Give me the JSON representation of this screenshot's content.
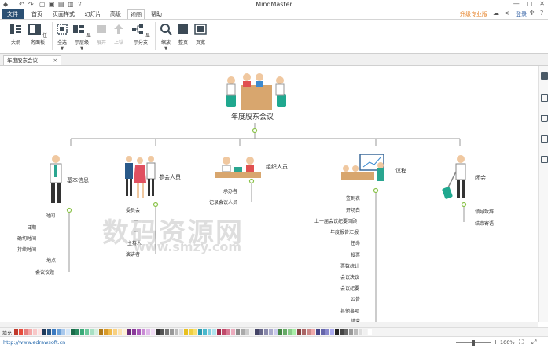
{
  "app": {
    "title": "MindMaster",
    "upgrade": "升级专业版",
    "login": "登录"
  },
  "tabs": [
    "文件",
    "首页",
    "页面样式",
    "幻灯片",
    "高级",
    "视图",
    "帮助"
  ],
  "active_tab": "视图",
  "ribbon": {
    "outline": "大纲",
    "task_panel": "任务面板",
    "select_all": "全选",
    "show_level": "显示层级",
    "expand": "展开",
    "move_up": "上钻",
    "show_branch": "显示分支",
    "zoom": "缩放",
    "fit_page": "整页",
    "page_width": "页宽"
  },
  "doc_tab": "年度股东会议",
  "mindmap": {
    "root": "年度股东会议",
    "branches": [
      {
        "label": "基本信息",
        "children": [
          "时间",
          "日期",
          "确切时间",
          "持续时间",
          "地点",
          "会议议题"
        ]
      },
      {
        "label": "参会人员",
        "children": [
          "委员会",
          "…",
          "…",
          "主持人",
          "演讲者"
        ]
      },
      {
        "label": "组织人员",
        "children": [
          "承办者",
          "记录会议人员"
        ]
      },
      {
        "label": "议程",
        "children": [
          "签到表",
          "开场白",
          "上一届会议纪要回顾",
          "年度报告汇报",
          "任命",
          "投票",
          "票数统计",
          "会议决议",
          "会议纪要",
          "公告",
          "其他事项",
          "结束"
        ]
      },
      {
        "label": "闭会",
        "children": [
          "领导致辞",
          "结束寄语"
        ]
      }
    ]
  },
  "watermark": {
    "line1": "数码资源网",
    "line2": "www.smzy.com"
  },
  "palette_label": "填充",
  "status": {
    "url": "http://www.edrawsoft.cn",
    "zoom": "100%"
  },
  "colors": {
    "file_tab": "#2a4f73",
    "connector": "#999999",
    "node_dot": "#8bc34a",
    "link": "#2266aa"
  },
  "icons": [
    "undo-icon",
    "redo-icon",
    "save-icon",
    "print-icon",
    "outline-icon",
    "task-panel-icon",
    "select-all-icon",
    "show-level-icon",
    "expand-icon",
    "drill-up-icon",
    "show-branch-icon",
    "zoom-icon",
    "fit-page-icon",
    "page-width-icon"
  ]
}
